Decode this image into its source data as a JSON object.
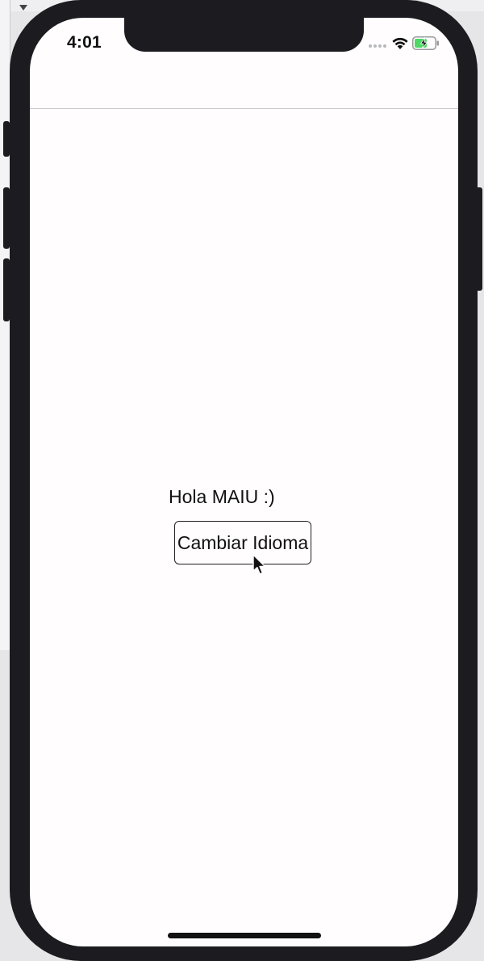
{
  "status_bar": {
    "time": "4:01"
  },
  "content": {
    "greeting": "Hola MAIU :)",
    "change_language_button_label": "Cambiar Idioma"
  },
  "colors": {
    "screen_background": "#fffdfe",
    "device_frame": "#1c1b1f",
    "battery_fill": "#4cd964"
  },
  "icons": [
    "wifi-icon",
    "battery-charging-icon",
    "mouse-pointer-icon"
  ]
}
